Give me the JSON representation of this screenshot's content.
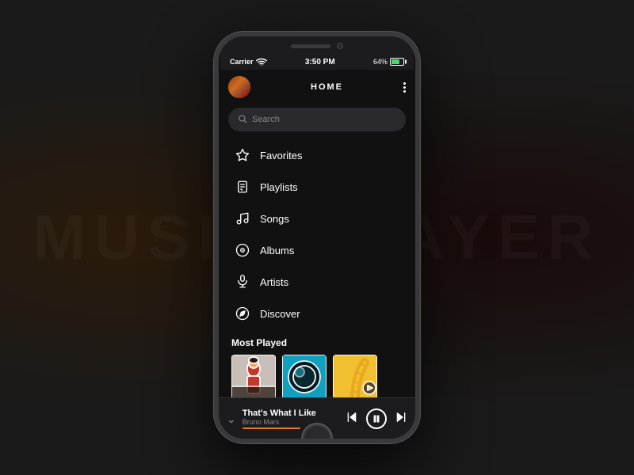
{
  "status_bar": {
    "carrier": "Carrier",
    "time": "3:50 PM",
    "battery_percent": "64%"
  },
  "header": {
    "title": "HOME"
  },
  "search": {
    "placeholder": "Search"
  },
  "nav": {
    "items": [
      {
        "id": "favorites",
        "label": "Favorites",
        "icon": "star"
      },
      {
        "id": "playlists",
        "label": "Playlists",
        "icon": "playlist"
      },
      {
        "id": "songs",
        "label": "Songs",
        "icon": "music-note"
      },
      {
        "id": "albums",
        "label": "Albums",
        "icon": "vinyl"
      },
      {
        "id": "artists",
        "label": "Artists",
        "icon": "mic"
      },
      {
        "id": "discover",
        "label": "Discover",
        "icon": "compass"
      }
    ]
  },
  "most_played": {
    "section_title": "Most Played",
    "albums": [
      {
        "id": 1,
        "bg": "#c8c8c0"
      },
      {
        "id": 2,
        "bg": "#1a9ab0"
      },
      {
        "id": 3,
        "bg": "#f0c030"
      }
    ]
  },
  "now_playing": {
    "title": "That's What I Like",
    "artist": "Bruno Mars"
  }
}
